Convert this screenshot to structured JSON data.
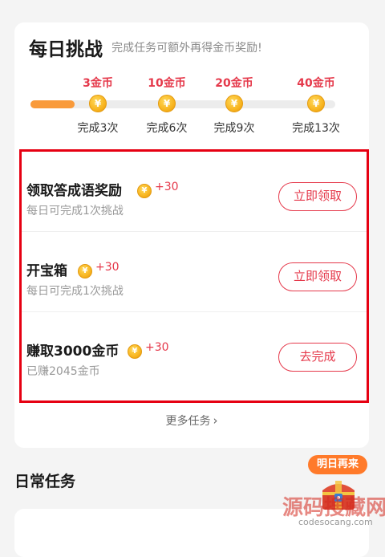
{
  "daily_challenge": {
    "title": "每日挑战",
    "subtitle": "完成任务可额外再得金币奖励!",
    "progress": {
      "completed": 0
    },
    "milestones": [
      {
        "reward": "3金币",
        "label": "完成3次"
      },
      {
        "reward": "10金币",
        "label": "完成6次"
      },
      {
        "reward": "20金币",
        "label": "完成9次"
      },
      {
        "reward": "40金币",
        "label": "完成13次"
      }
    ],
    "tasks": [
      {
        "name": "领取答成语奖励",
        "bonus": "+30",
        "desc": "每日可完成1次挑战",
        "button": "立即领取"
      },
      {
        "name": "开宝箱",
        "bonus": "+30",
        "desc": "每日可完成1次挑战",
        "button": "立即领取"
      },
      {
        "name": "赚取3000金币",
        "bonus": "+30",
        "desc": "已赚2045金币",
        "button": "去完成"
      }
    ],
    "more_label": "更多任务",
    "more_icon": "chevron-right-icon"
  },
  "coin_symbol": "¥",
  "daily_tasks": {
    "title": "日常任务"
  },
  "floating": {
    "badge": "明日再来",
    "icon": "treasure-chest-icon"
  },
  "watermark": {
    "logo": "源码搜藏网",
    "url": "codesocang.com"
  },
  "colors": {
    "accent_red": "#e5394b",
    "progress_orange": "#f99a3a",
    "highlight_border": "#e60012",
    "coin_gold": "#f7b21c"
  }
}
